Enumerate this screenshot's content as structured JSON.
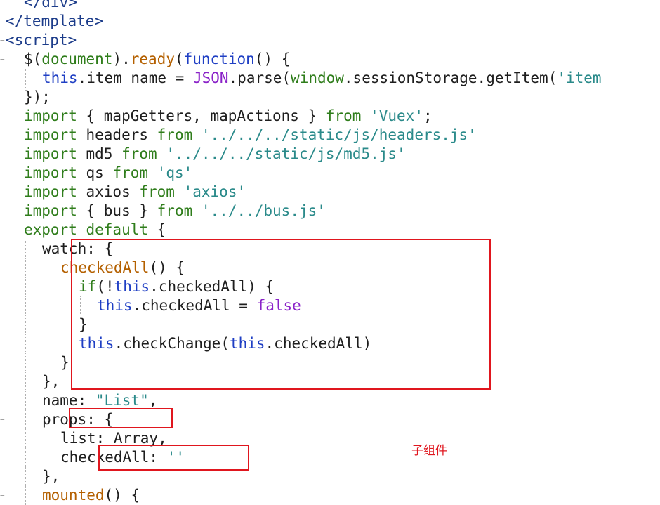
{
  "code_lines": [
    {
      "indent": 2,
      "tokens": [
        {
          "t": "</div>",
          "c": "tag"
        }
      ]
    },
    {
      "indent": 0,
      "tokens": [
        {
          "t": "</template>",
          "c": "tag"
        }
      ]
    },
    {
      "indent": 0,
      "fold": true,
      "tokens": [
        {
          "t": "<script>",
          "c": "tag"
        }
      ]
    },
    {
      "indent": 2,
      "fold": true,
      "tokens": [
        {
          "t": "$(",
          "c": "plain"
        },
        {
          "t": "document",
          "c": "kw"
        },
        {
          "t": ").",
          "c": "plain"
        },
        {
          "t": "ready",
          "c": "fn"
        },
        {
          "t": "(",
          "c": "plain"
        },
        {
          "t": "function",
          "c": "this"
        },
        {
          "t": "() {",
          "c": "plain"
        }
      ]
    },
    {
      "indent": 4,
      "tokens": [
        {
          "t": "this",
          "c": "this"
        },
        {
          "t": ".item_name = ",
          "c": "plain"
        },
        {
          "t": "JSON",
          "c": "cls"
        },
        {
          "t": ".parse(",
          "c": "plain"
        },
        {
          "t": "window",
          "c": "kw"
        },
        {
          "t": ".sessionStorage.getItem(",
          "c": "plain"
        },
        {
          "t": "'item_",
          "c": "str"
        }
      ]
    },
    {
      "indent": 2,
      "tokens": [
        {
          "t": "});",
          "c": "plain"
        }
      ]
    },
    {
      "indent": 2,
      "tokens": [
        {
          "t": "import",
          "c": "kw"
        },
        {
          "t": " { mapGetters, mapActions } ",
          "c": "plain"
        },
        {
          "t": "from",
          "c": "kw"
        },
        {
          "t": " ",
          "c": "plain"
        },
        {
          "t": "'Vuex'",
          "c": "str"
        },
        {
          "t": ";",
          "c": "plain"
        }
      ]
    },
    {
      "indent": 2,
      "tokens": [
        {
          "t": "import",
          "c": "kw"
        },
        {
          "t": " headers ",
          "c": "plain"
        },
        {
          "t": "from",
          "c": "kw"
        },
        {
          "t": " ",
          "c": "plain"
        },
        {
          "t": "'../../../static/js/headers.js'",
          "c": "str"
        }
      ]
    },
    {
      "indent": 2,
      "tokens": [
        {
          "t": "import",
          "c": "kw"
        },
        {
          "t": " md5 ",
          "c": "plain"
        },
        {
          "t": "from",
          "c": "kw"
        },
        {
          "t": " ",
          "c": "plain"
        },
        {
          "t": "'../../../static/js/md5.js'",
          "c": "str"
        }
      ]
    },
    {
      "indent": 2,
      "tokens": [
        {
          "t": "import",
          "c": "kw"
        },
        {
          "t": " qs ",
          "c": "plain"
        },
        {
          "t": "from",
          "c": "kw"
        },
        {
          "t": " ",
          "c": "plain"
        },
        {
          "t": "'qs'",
          "c": "str"
        }
      ]
    },
    {
      "indent": 2,
      "tokens": [
        {
          "t": "import",
          "c": "kw"
        },
        {
          "t": " axios ",
          "c": "plain"
        },
        {
          "t": "from",
          "c": "kw"
        },
        {
          "t": " ",
          "c": "plain"
        },
        {
          "t": "'axios'",
          "c": "str"
        }
      ]
    },
    {
      "indent": 2,
      "tokens": [
        {
          "t": "import",
          "c": "kw"
        },
        {
          "t": " { bus } ",
          "c": "plain"
        },
        {
          "t": "from",
          "c": "kw"
        },
        {
          "t": " ",
          "c": "plain"
        },
        {
          "t": "'../../bus.js'",
          "c": "str"
        }
      ]
    },
    {
      "indent": 2,
      "tokens": [
        {
          "t": "export default",
          "c": "kw"
        },
        {
          "t": " {",
          "c": "plain"
        }
      ]
    },
    {
      "indent": 4,
      "fold": true,
      "tokens": [
        {
          "t": "watch: {",
          "c": "plain"
        }
      ]
    },
    {
      "indent": 6,
      "fold": true,
      "tokens": [
        {
          "t": "checkedAll",
          "c": "fn"
        },
        {
          "t": "() {",
          "c": "plain"
        }
      ]
    },
    {
      "indent": 8,
      "fold": true,
      "tokens": [
        {
          "t": "if",
          "c": "kw"
        },
        {
          "t": "(!",
          "c": "plain"
        },
        {
          "t": "this",
          "c": "this"
        },
        {
          "t": ".checkedAll) {",
          "c": "plain"
        }
      ]
    },
    {
      "indent": 10,
      "tokens": [
        {
          "t": "this",
          "c": "this"
        },
        {
          "t": ".checkedAll = ",
          "c": "plain"
        },
        {
          "t": "false",
          "c": "bool"
        }
      ]
    },
    {
      "indent": 8,
      "tokens": [
        {
          "t": "}",
          "c": "plain"
        }
      ]
    },
    {
      "indent": 8,
      "tokens": [
        {
          "t": "this",
          "c": "this"
        },
        {
          "t": ".checkChange(",
          "c": "plain"
        },
        {
          "t": "this",
          "c": "this"
        },
        {
          "t": ".checkedAll)",
          "c": "plain"
        }
      ]
    },
    {
      "indent": 6,
      "tokens": [
        {
          "t": "}",
          "c": "plain"
        }
      ]
    },
    {
      "indent": 4,
      "tokens": [
        {
          "t": "},",
          "c": "plain"
        }
      ]
    },
    {
      "indent": 4,
      "tokens": [
        {
          "t": "name",
          "c": "plain"
        },
        {
          "t": ": ",
          "c": "plain"
        },
        {
          "t": "\"List\"",
          "c": "str"
        },
        {
          "t": ",",
          "c": "plain"
        }
      ]
    },
    {
      "indent": 4,
      "fold": true,
      "tokens": [
        {
          "t": "props: {",
          "c": "plain"
        }
      ]
    },
    {
      "indent": 6,
      "tokens": [
        {
          "t": "list: Array,",
          "c": "plain"
        }
      ]
    },
    {
      "indent": 6,
      "tokens": [
        {
          "t": "checkedAll: ",
          "c": "plain"
        },
        {
          "t": "''",
          "c": "str"
        }
      ]
    },
    {
      "indent": 4,
      "tokens": [
        {
          "t": "},",
          "c": "plain"
        }
      ]
    },
    {
      "indent": 4,
      "fold": true,
      "tokens": [
        {
          "t": "mounted",
          "c": "fn"
        },
        {
          "t": "() {",
          "c": "plain"
        }
      ]
    }
  ],
  "annotation": {
    "note": "子组件"
  },
  "highlight_boxes": [
    {
      "label": "watch-block"
    },
    {
      "label": "props-line"
    },
    {
      "label": "checkedAll-prop"
    }
  ],
  "colors": {
    "tag": "#1c3c8a",
    "keyword": "#2f7d1b",
    "function": "#b46000",
    "this": "#1f3fc4",
    "string": "#2a8a8a",
    "class": "#8a22c8",
    "highlight": "#e0161e"
  }
}
